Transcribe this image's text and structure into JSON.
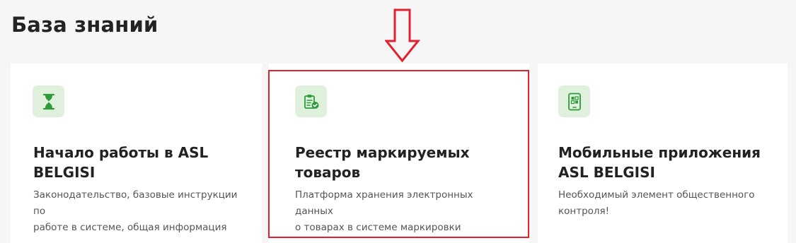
{
  "page": {
    "title": "База знаний"
  },
  "cards": [
    {
      "icon": "hourglass-icon",
      "title_line1": "Начало работы в ASL",
      "title_line2": "BELGISI",
      "desc_line1": "Законодательство, базовые инструкции по",
      "desc_line2": "работе в системе, общая информация"
    },
    {
      "icon": "clipboard-check-icon",
      "title_line1": "Реестр маркируемых",
      "title_line2": "товаров",
      "desc_line1": "Платформа хранения электронных данных",
      "desc_line2": "о товарах в системе маркировки"
    },
    {
      "icon": "mobile-app-icon",
      "title_line1": "Мобильные приложения",
      "title_line2": "ASL BELGISI",
      "desc_line1": "Необходимый элемент общественного",
      "desc_line2": "контроля!"
    }
  ],
  "colors": {
    "accent_green": "#2e9a3a",
    "icon_bg": "#dff1dc",
    "highlight_red": "#e0232f"
  }
}
